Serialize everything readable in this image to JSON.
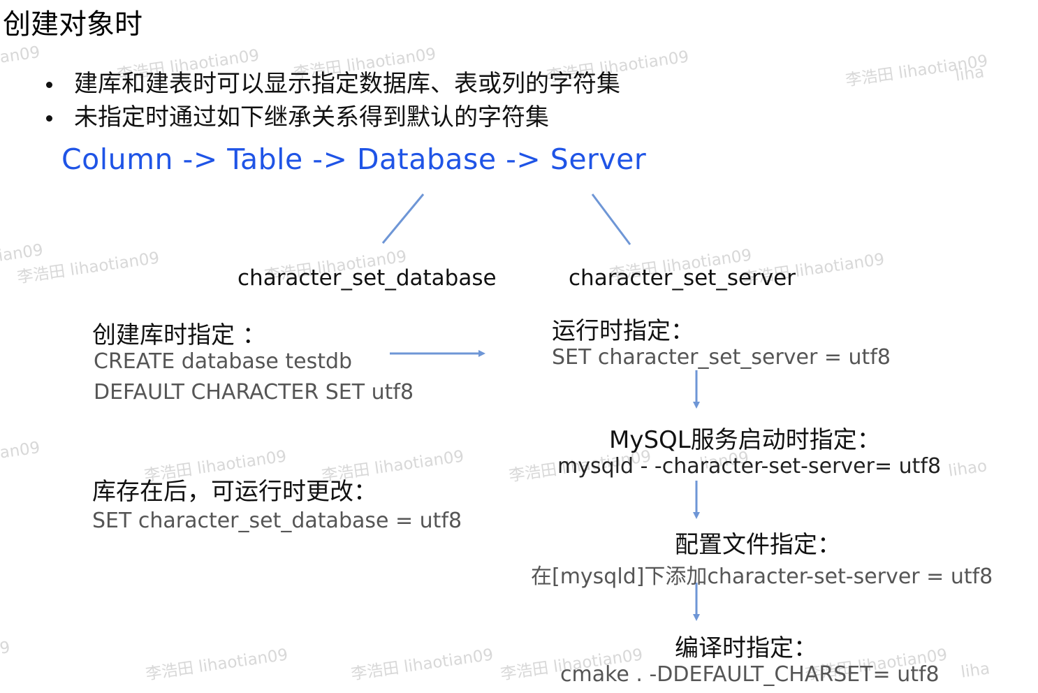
{
  "title": "创建对象时",
  "bullets": [
    "建库和建表时可以显示指定数据库、表或列的字符集",
    "未指定时通过如下继承关系得到默认的字符集"
  ],
  "chain": "Column -> Table -> Database -> Server",
  "vars": {
    "database": "character_set_database",
    "server": "character_set_server"
  },
  "left": {
    "create_heading": "创建库时指定 ：",
    "create_code_1": "CREATE database testdb",
    "create_code_2": "DEFAULT CHARACTER SET utf8",
    "alter_heading": "库存在后，可运行时更改：",
    "alter_code": "SET character_set_database = utf8"
  },
  "right": {
    "runtime_heading": "运行时指定：",
    "runtime_code": "SET character_set_server = utf8",
    "startup_heading": "MySQL服务启动时指定：",
    "startup_code": "mysqld  - -character-set-server= utf8",
    "config_heading": "配置文件指定：",
    "config_code": "在[mysqld]下添加character-set-server = utf8",
    "compile_heading": "编译时指定：",
    "compile_code": "cmake . -DDEFAULT_CHARSET= utf8"
  },
  "watermark": {
    "text": "李浩田 lihaotian09",
    "fragments": [
      "an09",
      "ian09",
      "lian09",
      "liha",
      "lihao",
      "9"
    ]
  },
  "colors": {
    "accent_blue": "#1f54e6",
    "arrow_blue": "#6e96d6",
    "code_gray": "#555555",
    "watermark_gray": "#d8d8d8"
  }
}
